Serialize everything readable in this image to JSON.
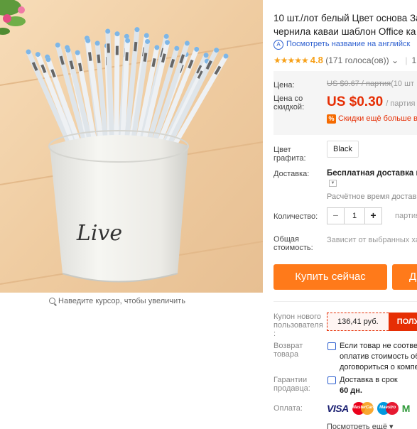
{
  "product": {
    "title_line1": "10 шт./лот белый Цвет основа За",
    "title_line2": "чернила каваи шаблон Office ка",
    "translate_link": "Посмотреть название на английск",
    "rating_value": "4.8",
    "rating_count": "(171 голоса(ов))",
    "rating_tail": "1",
    "stars": "★★★★★"
  },
  "gallery": {
    "zoom_hint": "Наведите курсор, чтобы увеличить",
    "cup_text": "Live"
  },
  "price": {
    "label": "Цена:",
    "old_value": "US $0.67 / партия",
    "old_tail": " (10 шт",
    "discount_label": "Цена со скидкой:",
    "new_value": "US $0.30",
    "new_tail": "/ партия",
    "discount_note": "Скидки ещё больше в"
  },
  "options": {
    "color_label": "Цвет графита:",
    "color_value": "Black",
    "shipping_label": "Доставка:",
    "shipping_value": "Бесплатная доставка в",
    "shipping_time": "Расчётное время доставки",
    "qty_label": "Количество:",
    "qty_value": "1",
    "qty_tail": "партия",
    "total_label": "Общая стоимость:",
    "total_value": "Зависит от выбранных ха"
  },
  "actions": {
    "buy_now": "Купить сейчас",
    "add_cart": "Д"
  },
  "services": {
    "coupon_label": "Купон нового пользователя :",
    "coupon_amount": "136,41 руб.",
    "coupon_get": "ПОЛУ",
    "return_label": "Возврат товара",
    "return_line1": "Если товар не соответ",
    "return_line2": "оплатив стоимость об",
    "return_line3": "договориться о компе",
    "guarantee_label": "Гарантии продавца:",
    "guarantee_line1": "Доставка в срок",
    "guarantee_line2": "60 дн.",
    "payment_label": "Оплата:",
    "visa": "VISA",
    "mastercard": "MasterCard",
    "maestro": "Maestro",
    "more_payment": "M",
    "see_more": "Посмотреть ещё ▾"
  },
  "colors": {
    "accent_orange": "#ff7a1a",
    "price_red": "#e62e04",
    "link_blue": "#2b5ecf",
    "star_gold": "#f7a11a"
  }
}
